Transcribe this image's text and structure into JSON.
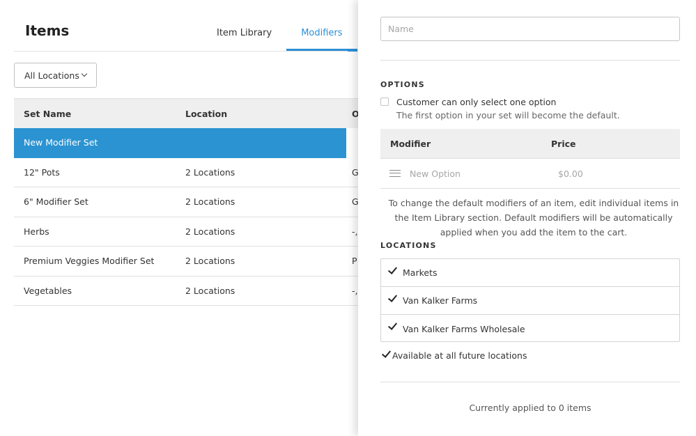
{
  "header": {
    "title": "Items"
  },
  "tabs": [
    {
      "label": "Item Library",
      "active": false
    },
    {
      "label": "Modifiers",
      "active": true
    }
  ],
  "location_filter": {
    "label": "All Locations"
  },
  "table": {
    "columns": [
      "Set Name",
      "Location",
      "O"
    ],
    "rows": [
      {
        "name": "New Modifier Set",
        "location": "",
        "options": "",
        "selected": true
      },
      {
        "name": "12\" Pots",
        "location": "2 Locations",
        "options": "G"
      },
      {
        "name": "6\" Modifier Set",
        "location": "2 Locations",
        "options": "G"
      },
      {
        "name": "Herbs",
        "location": "2 Locations",
        "options": "-,"
      },
      {
        "name": "Premium Veggies Modifier Set",
        "location": "2 Locations",
        "options": "P"
      },
      {
        "name": "Vegetables",
        "location": "2 Locations",
        "options": "-,"
      }
    ]
  },
  "drawer": {
    "name_placeholder": "Name",
    "options_title": "OPTIONS",
    "single_option_label": "Customer can only select one option",
    "single_option_help": "The first option in your set will become the default.",
    "modifier_header": "Modifier",
    "price_header": "Price",
    "new_option_placeholder": "New Option",
    "price_placeholder": "$0.00",
    "note": "To change the default modifiers of an item, edit individual items in the Item Library section. Default modifiers will be automatically applied when you add the item to the cart.",
    "locations_title": "LOCATIONS",
    "locations": [
      {
        "label": "Markets",
        "checked": true
      },
      {
        "label": "Van Kalker Farms",
        "checked": true
      },
      {
        "label": "Van Kalker Farms Wholesale",
        "checked": true
      }
    ],
    "future_label": "Available at all future locations",
    "applied_text": "Currently applied to 0 items"
  },
  "colors": {
    "accent": "#2b8fd6",
    "selected_row": "#2b93d1",
    "header_bg": "#efefef"
  }
}
